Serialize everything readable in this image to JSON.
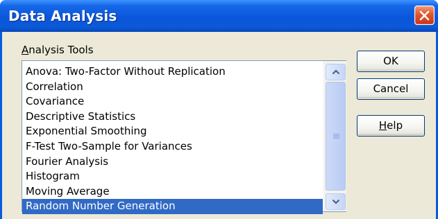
{
  "window": {
    "title": "Data Analysis"
  },
  "analysis_tools": {
    "label_accel": "A",
    "label_rest": "nalysis Tools",
    "items": [
      "Anova: Two-Factor Without Replication",
      "Correlation",
      "Covariance",
      "Descriptive Statistics",
      "Exponential Smoothing",
      "F-Test Two-Sample for Variances",
      "Fourier Analysis",
      "Histogram",
      "Moving Average",
      "Random Number Generation"
    ],
    "selected_index": 9
  },
  "buttons": {
    "ok": "OK",
    "cancel": "Cancel",
    "help_accel": "H",
    "help_rest": "elp"
  },
  "colors": {
    "titlebar": "#0a56db",
    "selection": "#316ac5",
    "dialog_bg": "#ece9d8"
  },
  "icons": {
    "close": "close-icon",
    "scroll_up": "arrow-up-icon",
    "scroll_down": "arrow-down-icon"
  }
}
